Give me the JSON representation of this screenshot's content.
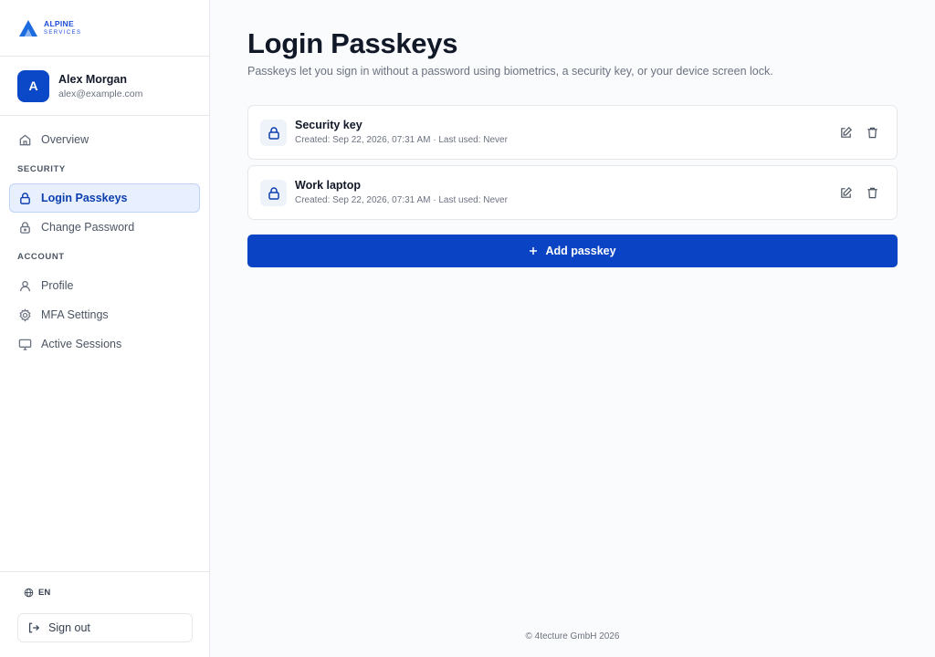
{
  "brand": {
    "name": "ALPINE",
    "sub": "SERVICES",
    "icon": "alpine-logo-icon"
  },
  "user": {
    "initial": "A",
    "name": "Alex Morgan",
    "email": "alex@example.com"
  },
  "nav": {
    "overview": "Overview",
    "security_section": "SECURITY",
    "login_passkeys": "Login Passkeys",
    "change_password": "Change Password",
    "account_section": "ACCOUNT",
    "profile": "Profile",
    "mfa_settings": "MFA Settings",
    "active_sessions": "Active Sessions"
  },
  "footer_left": {
    "language": "EN",
    "sign_out": "Sign out"
  },
  "main": {
    "title": "Login Passkeys",
    "subtitle": "Passkeys let you sign in without a password using biometrics, a security key, or your device screen lock.",
    "passkeys": [
      {
        "name": "Security key",
        "meta": "Created: Sep 22, 2026, 07:31 AM · Last used: Never"
      },
      {
        "name": "Work laptop",
        "meta": "Created: Sep 22, 2026, 07:31 AM · Last used: Never"
      }
    ],
    "add_button": "Add passkey",
    "footer": "© 4tecture GmbH 2026"
  },
  "colors": {
    "accent": "#0a44c4",
    "active_bg": "#e8efff"
  }
}
